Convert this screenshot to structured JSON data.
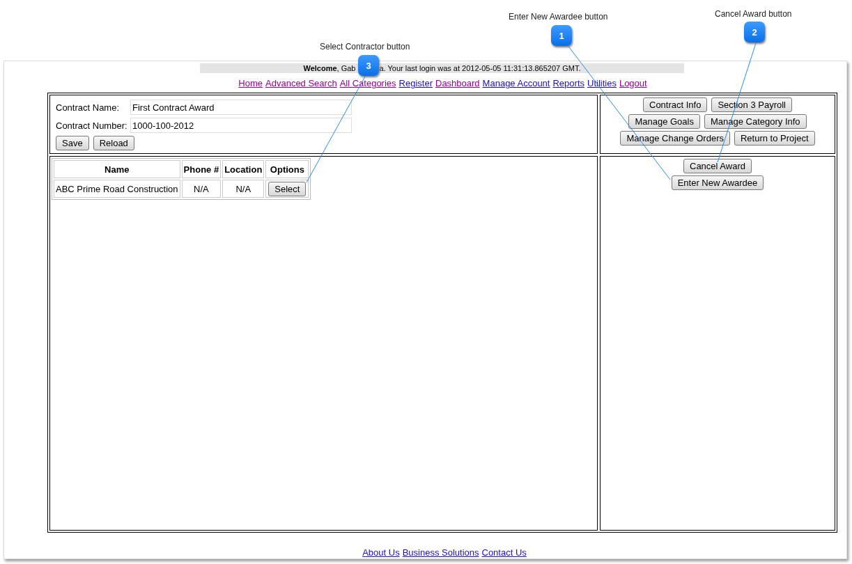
{
  "annotations": [
    {
      "number": "1",
      "label": "Enter New Awardee button"
    },
    {
      "number": "2",
      "label": "Cancel Award button"
    },
    {
      "number": "3",
      "label": "Select Contractor button"
    }
  ],
  "welcome": {
    "before": "**Welcome**, Gab",
    "after": "a. Your last login was at 2012-05-05 11:31:13.865207 GMT."
  },
  "nav_links": [
    {
      "label": "Home",
      "visited": true
    },
    {
      "label": "Advanced Search",
      "visited": true
    },
    {
      "label": "All Categories",
      "visited": true
    },
    {
      "label": "Register",
      "visited": false
    },
    {
      "label": "Dashboard",
      "visited": true
    },
    {
      "label": "Manage Account",
      "visited": false
    },
    {
      "label": "Reports",
      "visited": false
    },
    {
      "label": "Utilities",
      "visited": false
    },
    {
      "label": "Logout",
      "visited": true
    }
  ],
  "form": {
    "fields": [
      {
        "label": "Contract Name:",
        "value": "First Contract Award"
      },
      {
        "label": "Contract Number:",
        "value": "1000-100-2012"
      }
    ],
    "buttons": [
      "Save",
      "Reload"
    ]
  },
  "contractors": {
    "columns": [
      "Name",
      "Phone #",
      "Location",
      "Options"
    ],
    "rows": [
      {
        "name": "ABC Prime Road Construction",
        "phone": "N/A",
        "location": "N/A",
        "action": "Select"
      }
    ]
  },
  "project_buttons": [
    [
      "Contract Info",
      "Section 3 Payroll"
    ],
    [
      "Manage Goals",
      "Manage Category Info"
    ],
    [
      "Manage Change Orders",
      "Return to Project"
    ]
  ],
  "award_buttons": [
    "Cancel Award",
    "Enter New Awardee"
  ],
  "footer_links": [
    {
      "label": "About Us",
      "visited": false
    },
    {
      "label": "Business Solutions",
      "visited": false
    },
    {
      "label": "Contact Us",
      "visited": false
    }
  ]
}
